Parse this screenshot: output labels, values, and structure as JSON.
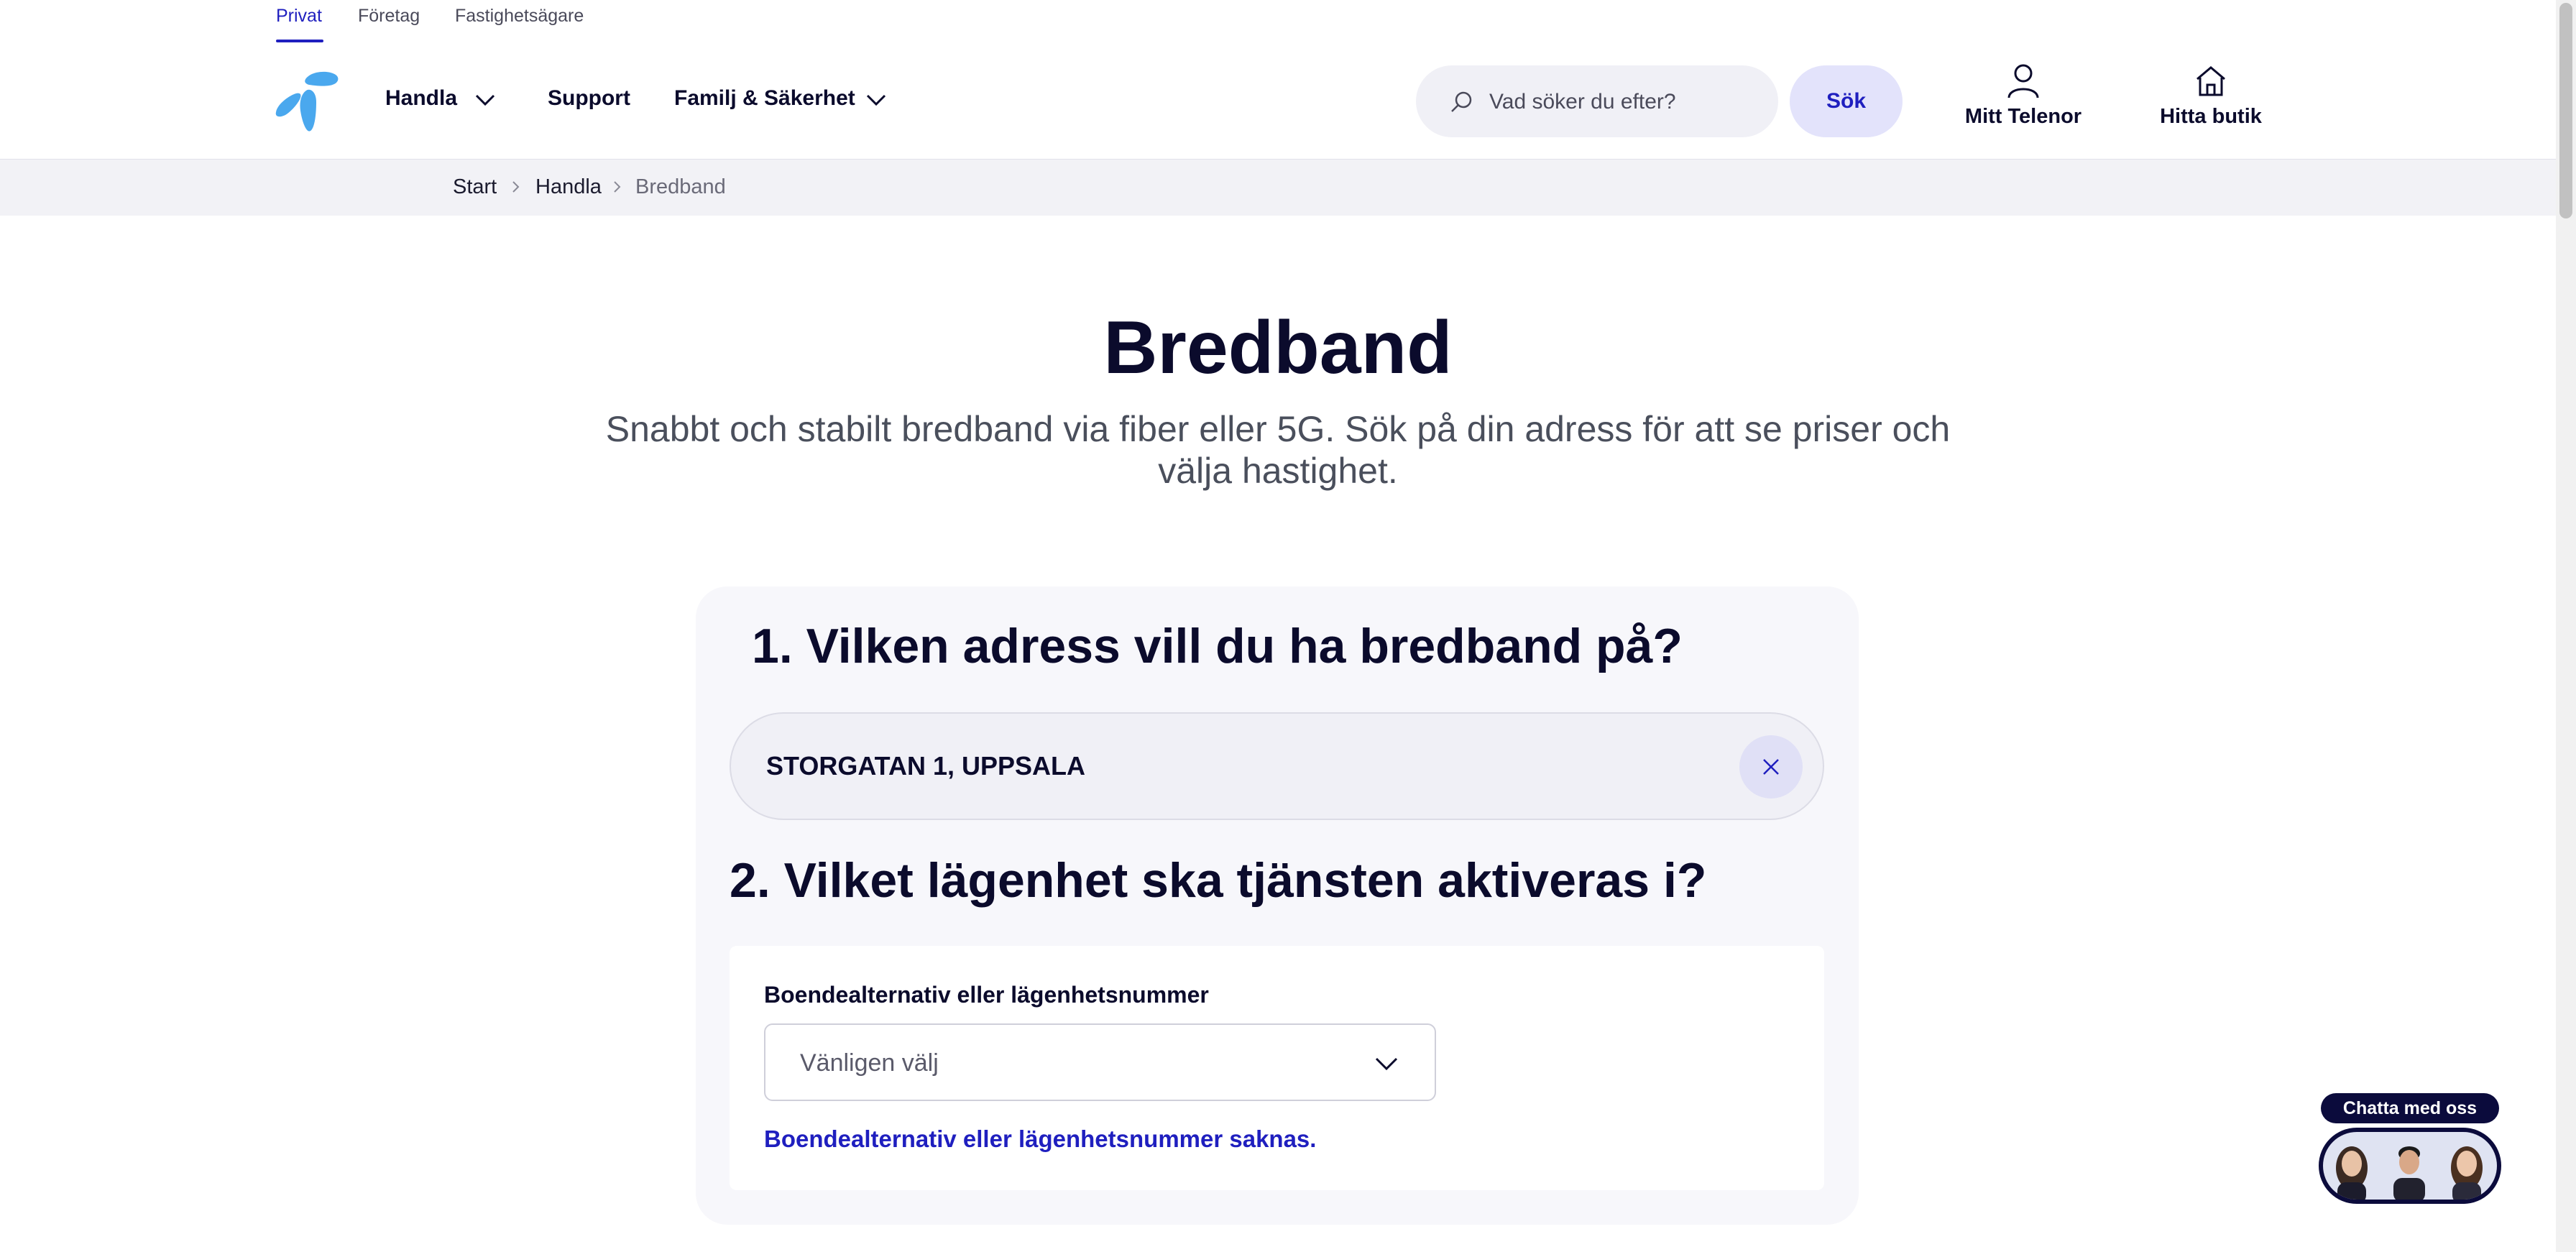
{
  "segments": [
    "Privat",
    "Företag",
    "Fastighetsägare"
  ],
  "nav": {
    "handla": "Handla",
    "support": "Support",
    "familj": "Familj & Säkerhet"
  },
  "search": {
    "placeholder": "Vad söker du efter?",
    "button": "Sök"
  },
  "utility": {
    "account": "Mitt Telenor",
    "store": "Hitta butik"
  },
  "breadcrumb": [
    "Start",
    "Handla",
    "Bredband"
  ],
  "hero": {
    "title": "Bredband",
    "subtitle": "Snabbt och stabilt bredband via fiber eller 5G. Sök på din adress för att se priser och välja hastighet."
  },
  "form": {
    "q1": "1. Vilken adress vill du ha bredband på?",
    "address": "STORGATAN 1, UPPSALA",
    "q2": "2. Vilket lägenhet ska tjänsten aktiveras i?",
    "select_label": "Boendealternativ eller lägenhetsnummer",
    "select_value": "Vänligen välj",
    "missing_link": "Boendealternativ eller lägenhetsnummer saknas."
  },
  "chat": {
    "label": "Chatta med oss"
  },
  "colors": {
    "brand_blue": "#1f1fbf",
    "logo_blue": "#4aa8ee",
    "navy": "#0b0b2c",
    "surface": "#f7f7fb"
  },
  "icons": [
    "telenor-logo",
    "chevron-down-icon",
    "search-icon",
    "user-icon",
    "house-icon",
    "chevron-right-icon",
    "close-icon"
  ]
}
